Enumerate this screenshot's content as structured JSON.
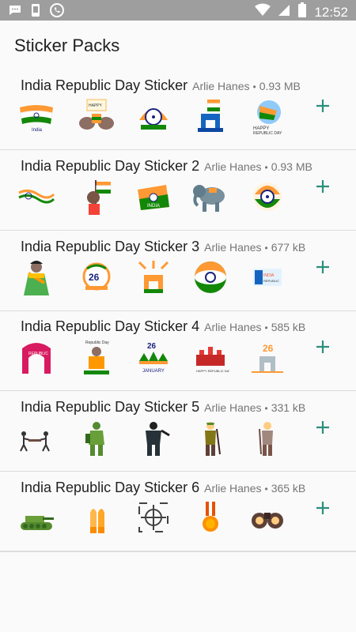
{
  "status_bar": {
    "time": "12:52"
  },
  "screen": {
    "title": "Sticker Packs"
  },
  "packs": [
    {
      "name": "India Republic Day Sticker",
      "author": "Arlie Hanes",
      "size": "0.93 MB",
      "stickers": [
        "flag-brush",
        "elephants-text",
        "chakra-emblem",
        "india-gate-flag",
        "flag-happy-republic"
      ]
    },
    {
      "name": "India Republic Day Sticker 2",
      "author": "Arlie Hanes",
      "size": "0.93 MB",
      "stickers": [
        "wave-flag",
        "boy-with-flag",
        "india-text",
        "elephant",
        "chakra-wreath"
      ]
    },
    {
      "name": "India Republic Day Sticker 3",
      "author": "Arlie Hanes",
      "size": "677 kB",
      "stickers": [
        "woman-in-saree",
        "badge-26",
        "jets-gate",
        "tricolor-circle",
        "republic-card"
      ]
    },
    {
      "name": "India Republic Day Sticker 4",
      "author": "Arlie Hanes",
      "size": "585 kB",
      "stickers": [
        "pink-arch",
        "lady-poster",
        "january-26",
        "red-fort",
        "gate-26"
      ]
    },
    {
      "name": "India Republic Day Sticker 5",
      "author": "Arlie Hanes",
      "size": "331 kB",
      "stickers": [
        "soldiers-carry",
        "soldier-heavy",
        "soldier-dark",
        "soldier-rifle",
        "soldier-old"
      ]
    },
    {
      "name": "India Republic Day Sticker 6",
      "author": "Arlie Hanes",
      "size": "365 kB",
      "stickers": [
        "tank",
        "bullets",
        "crosshair",
        "medal",
        "binoculars"
      ]
    }
  ],
  "colors": {
    "accent": "#2a8f7e",
    "status_bar": "#9e9e9e",
    "saffron": "#ff9933",
    "green": "#138808",
    "chakra": "#1a237e"
  }
}
